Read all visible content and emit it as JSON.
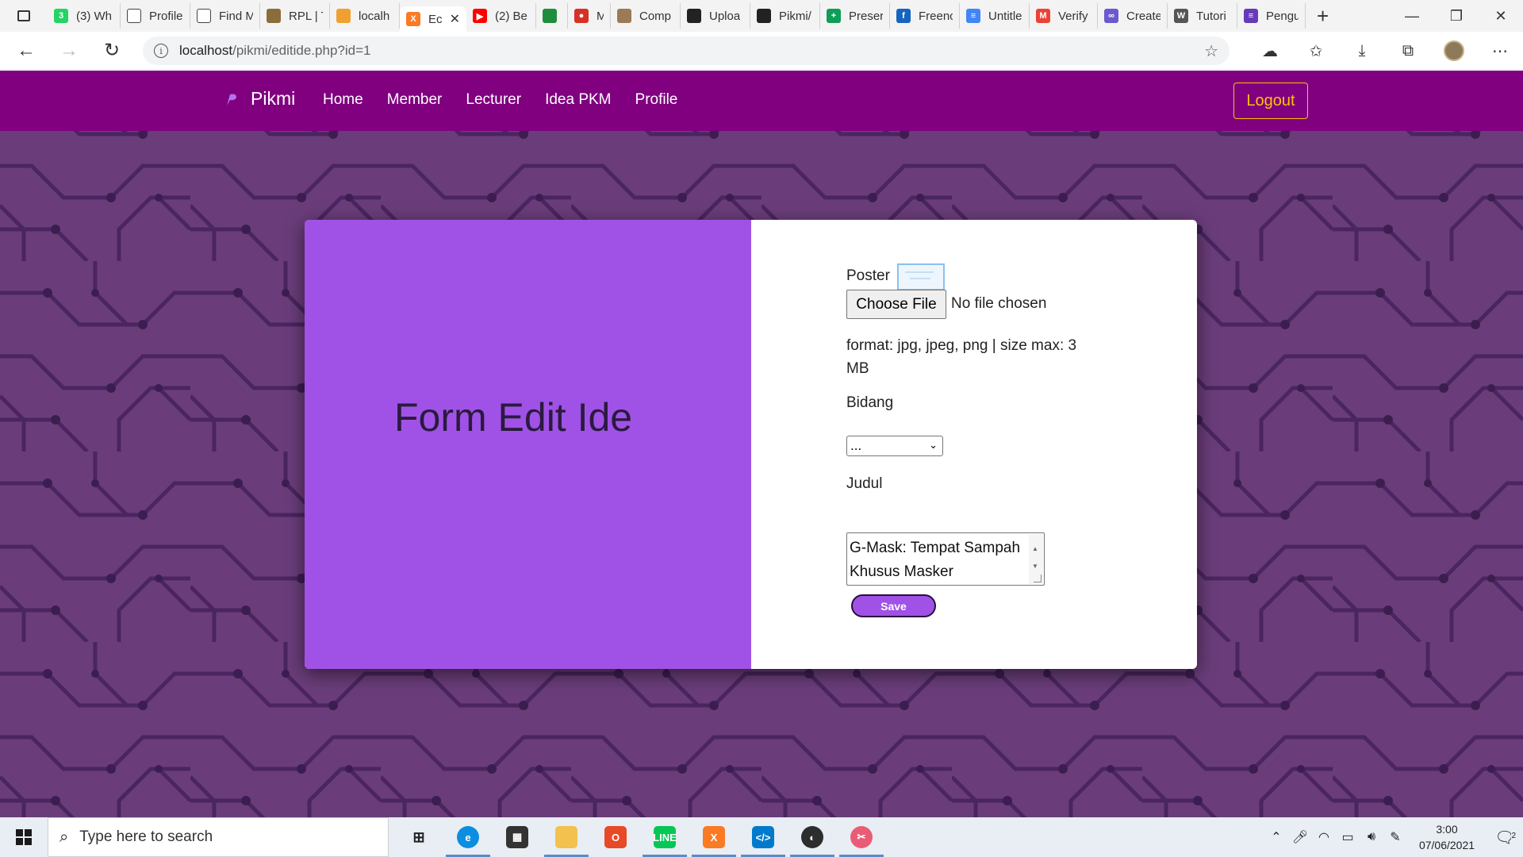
{
  "browser": {
    "tabs": [
      {
        "label": "(3) Wh",
        "icon": "whatsapp-icon",
        "color": "#25d366",
        "glyph": "3"
      },
      {
        "label": "Profile",
        "icon": "page-icon",
        "color": "#ffffff",
        "glyph": ""
      },
      {
        "label": "Find M",
        "icon": "page-icon",
        "color": "#ffffff",
        "glyph": ""
      },
      {
        "label": "RPL | T",
        "icon": "book-icon",
        "color": "#8a6d3b",
        "glyph": ""
      },
      {
        "label": "localh",
        "icon": "phpmyadmin-icon",
        "color": "#f0a030",
        "glyph": ""
      },
      {
        "label": "Ec",
        "icon": "xampp-icon",
        "color": "#fb7a24",
        "glyph": "X",
        "active": true
      },
      {
        "label": "(2) Be",
        "icon": "youtube-icon",
        "color": "#ff0000",
        "glyph": "▶"
      },
      {
        "label": "",
        "icon": "meet-icon",
        "color": "#1e8e3e",
        "glyph": ""
      },
      {
        "label": "M",
        "icon": "record-icon",
        "color": "#d93025",
        "glyph": "●"
      },
      {
        "label": "Comp",
        "icon": "cat-icon",
        "color": "#9c7a56",
        "glyph": ""
      },
      {
        "label": "Uploa",
        "icon": "github-icon",
        "color": "#222222",
        "glyph": ""
      },
      {
        "label": "Pikmi/",
        "icon": "github-icon",
        "color": "#222222",
        "glyph": ""
      },
      {
        "label": "Preser",
        "icon": "plus-icon",
        "color": "#0f9d58",
        "glyph": "+"
      },
      {
        "label": "Freenc",
        "icon": "freenom-icon",
        "color": "#1565c0",
        "glyph": "f"
      },
      {
        "label": "Untitle",
        "icon": "docs-icon",
        "color": "#4285f4",
        "glyph": "≡"
      },
      {
        "label": "Verify",
        "icon": "gmail-icon",
        "color": "#ea4335",
        "glyph": "M"
      },
      {
        "label": "Create",
        "icon": "infinity-icon",
        "color": "#6a5acd",
        "glyph": "∞"
      },
      {
        "label": "Tutori",
        "icon": "w3-icon",
        "color": "#555555",
        "glyph": "W"
      },
      {
        "label": "Pengu",
        "icon": "forms-icon",
        "color": "#673ab7",
        "glyph": "≡"
      }
    ],
    "url_host": "localhost",
    "url_path": "/pikmi/editide.php?id=1"
  },
  "nav": {
    "brand": "Pikmi",
    "links": [
      "Home",
      "Member",
      "Lecturer",
      "Idea PKM",
      "Profile"
    ],
    "logout": "Logout"
  },
  "form": {
    "title": "Form Edit Ide",
    "poster_label": "Poster",
    "choose_file": "Choose File",
    "no_file": "No file chosen",
    "format_hint": "format: jpg, jpeg, png | size max: 3 MB",
    "bidang_label": "Bidang",
    "bidang_value": "...",
    "judul_label": "Judul",
    "judul_value": "G-Mask: Tempat Sampah Khusus Masker",
    "save": "Save"
  },
  "taskbar": {
    "search_placeholder": "Type here to search",
    "time": "3:00",
    "date": "07/06/2021",
    "notifications": "2"
  },
  "colors": {
    "navbar": "#800080",
    "card_left": "#a052e6",
    "logout_accent": "#ffc107",
    "page_bg": "#6a3d7a"
  }
}
